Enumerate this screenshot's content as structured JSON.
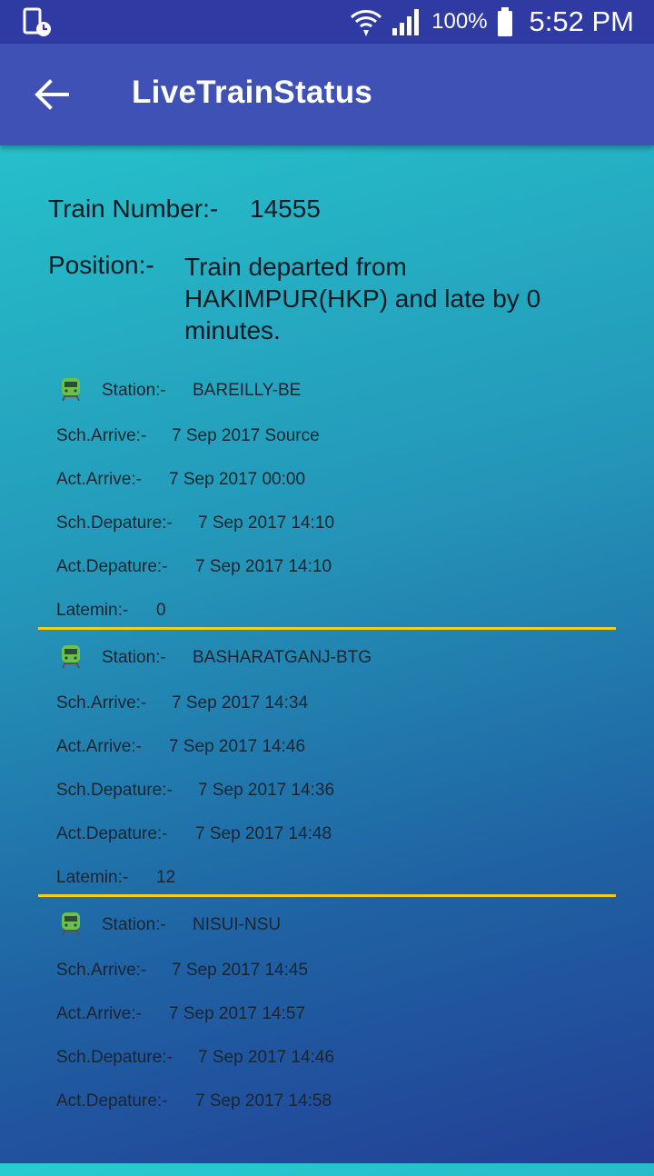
{
  "status_bar": {
    "battery": "100%",
    "time": "5:52 PM"
  },
  "app_bar": {
    "title": "LiveTrainStatus"
  },
  "train": {
    "number_label": "Train Number:-",
    "number": "14555",
    "position_label": "Position:-",
    "position": "Train departed from HAKIMPUR(HKP) and late by 0 minutes."
  },
  "labels": {
    "station": "Station:-",
    "sch_arrive": "Sch.Arrive:-",
    "act_arrive": "Act.Arrive:-",
    "sch_depart": "Sch.Depature:-",
    "act_depart": "Act.Depature:-",
    "latemin": "Latemin:-"
  },
  "stations": [
    {
      "station": "BAREILLY-BE",
      "sch_arrive": "7 Sep 2017 Source",
      "act_arrive": "7 Sep 2017 00:00",
      "sch_depart": "7 Sep 2017 14:10",
      "act_depart": "7 Sep 2017 14:10",
      "latemin": "0"
    },
    {
      "station": "BASHARATGANJ-BTG",
      "sch_arrive": "7 Sep 2017 14:34",
      "act_arrive": "7 Sep 2017 14:46",
      "sch_depart": "7 Sep 2017 14:36",
      "act_depart": "7 Sep 2017 14:48",
      "latemin": "12"
    },
    {
      "station": "NISUI-NSU",
      "sch_arrive": "7 Sep 2017 14:45",
      "act_arrive": "7 Sep 2017 14:57",
      "sch_depart": "7 Sep 2017 14:46",
      "act_depart": "7 Sep 2017 14:58",
      "latemin": ""
    }
  ],
  "icons": {
    "status_left": "phone-clock-icon",
    "wifi": "wifi-icon",
    "signal": "signal-icon",
    "battery": "battery-icon",
    "back": "arrow-back-icon",
    "train": "train-icon"
  },
  "colors": {
    "status_bar": "#2f3aa2",
    "app_bar": "#3f51b5",
    "divider": "#f6cf14",
    "train_icon": "#6bc24a"
  }
}
